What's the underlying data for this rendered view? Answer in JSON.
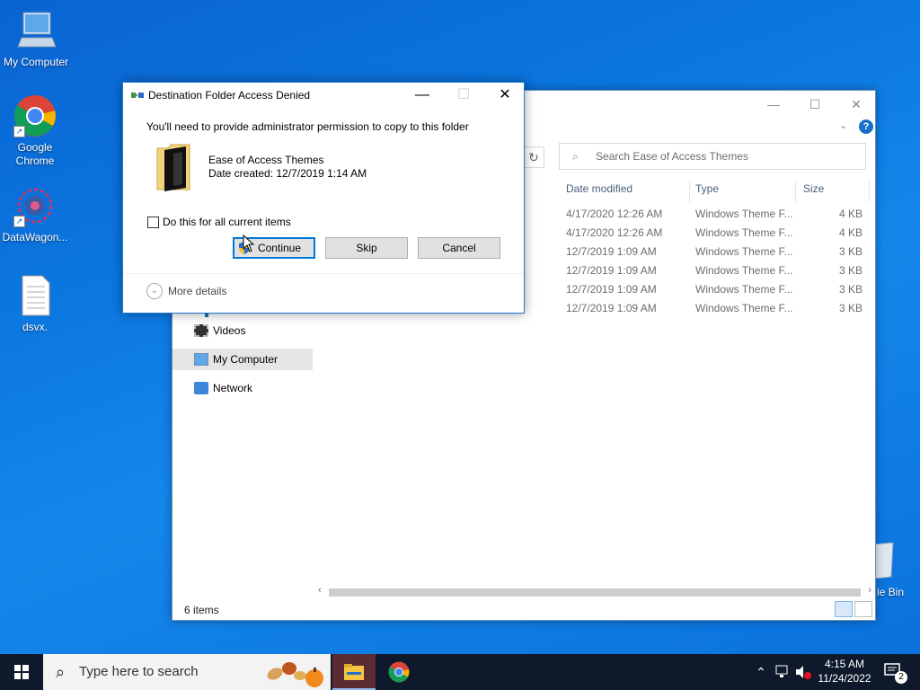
{
  "desktop": {
    "icons": [
      {
        "label": "My Computer"
      },
      {
        "label": "Google Chrome"
      },
      {
        "label": "DataWagon..."
      },
      {
        "label": "dsvx."
      }
    ],
    "recycle_bin_label": "le Bin"
  },
  "explorer": {
    "search_placeholder": "Search Ease of Access Themes",
    "columns": [
      "Date modified",
      "Type",
      "Size"
    ],
    "files": [
      {
        "date": "4/17/2020 12:26 AM",
        "type": "Windows Theme F...",
        "size": "4 KB"
      },
      {
        "date": "4/17/2020 12:26 AM",
        "type": "Windows Theme F...",
        "size": "4 KB"
      },
      {
        "date": "12/7/2019 1:09 AM",
        "type": "Windows Theme F...",
        "size": "3 KB"
      },
      {
        "date": "12/7/2019 1:09 AM",
        "type": "Windows Theme F...",
        "size": "3 KB"
      },
      {
        "date": "12/7/2019 1:09 AM",
        "type": "Windows Theme F...",
        "size": "3 KB"
      },
      {
        "date": "12/7/2019 1:09 AM",
        "type": "Windows Theme F...",
        "size": "3 KB"
      }
    ],
    "nav": [
      {
        "label": "Videos"
      },
      {
        "label": "My Computer"
      },
      {
        "label": "Network"
      }
    ],
    "status": "6 items"
  },
  "dialog": {
    "title": "Destination Folder Access Denied",
    "message": "You'll need to provide administrator permission to copy to this folder",
    "folder_name": "Ease of Access Themes",
    "folder_date": "Date created: 12/7/2019 1:14 AM",
    "checkbox_label": "Do this for all current items",
    "checkbox_checked": false,
    "buttons": {
      "continue": "Continue",
      "skip": "Skip",
      "cancel": "Cancel"
    },
    "more_details": "More details"
  },
  "taskbar": {
    "search_placeholder": "Type here to search",
    "clock_time": "4:15 AM",
    "clock_date": "11/24/2022",
    "notification_count": "2"
  },
  "colors": {
    "accent": "#0078d7",
    "taskbar": "#0e1a2b",
    "desktop": "#0b76e0"
  }
}
